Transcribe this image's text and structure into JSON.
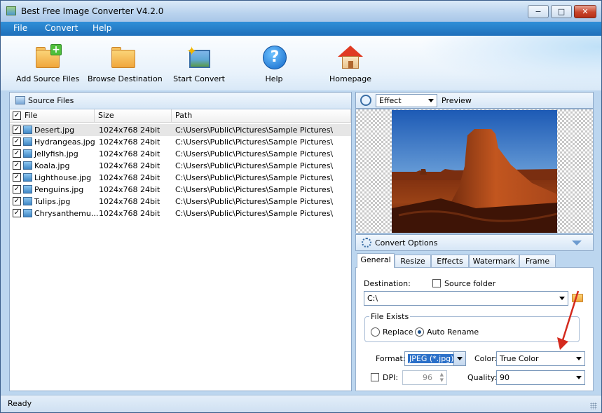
{
  "window": {
    "title": "Best Free Image Converter V4.2.0",
    "controls": {
      "minimize": "−",
      "maximize": "□",
      "close": "✕"
    }
  },
  "menubar": {
    "items": [
      "File",
      "Convert",
      "Help"
    ]
  },
  "toolbar": {
    "add_source_files": "Add Source Files",
    "browse_destination": "Browse Destination",
    "start_convert": "Start Convert",
    "help": "Help",
    "homepage": "Homepage"
  },
  "source_files": {
    "title": "Source Files",
    "columns": {
      "file": "File",
      "size": "Size",
      "path": "Path"
    },
    "rows": [
      {
        "checked": true,
        "file": "Desert.jpg",
        "size": "1024x768  24bit",
        "path": "C:\\Users\\Public\\Pictures\\Sample Pictures\\"
      },
      {
        "checked": true,
        "file": "Hydrangeas.jpg",
        "size": "1024x768  24bit",
        "path": "C:\\Users\\Public\\Pictures\\Sample Pictures\\"
      },
      {
        "checked": true,
        "file": "Jellyfish.jpg",
        "size": "1024x768  24bit",
        "path": "C:\\Users\\Public\\Pictures\\Sample Pictures\\"
      },
      {
        "checked": true,
        "file": "Koala.jpg",
        "size": "1024x768  24bit",
        "path": "C:\\Users\\Public\\Pictures\\Sample Pictures\\"
      },
      {
        "checked": true,
        "file": "Lighthouse.jpg",
        "size": "1024x768  24bit",
        "path": "C:\\Users\\Public\\Pictures\\Sample Pictures\\"
      },
      {
        "checked": true,
        "file": "Penguins.jpg",
        "size": "1024x768  24bit",
        "path": "C:\\Users\\Public\\Pictures\\Sample Pictures\\"
      },
      {
        "checked": true,
        "file": "Tulips.jpg",
        "size": "1024x768  24bit",
        "path": "C:\\Users\\Public\\Pictures\\Sample Pictures\\"
      },
      {
        "checked": true,
        "file": "Chrysanthemu...",
        "size": "1024x768  24bit",
        "path": "C:\\Users\\Public\\Pictures\\Sample Pictures\\"
      }
    ]
  },
  "preview": {
    "effect_value": "Effect",
    "label": "Preview"
  },
  "convert_options": {
    "title": "Convert Options",
    "tabs": [
      "General",
      "Resize",
      "Effects",
      "Watermark",
      "Frame"
    ],
    "active_tab": "General",
    "destination_label": "Destination:",
    "source_folder_label": "Source folder",
    "source_folder_checked": false,
    "destination_value": "C:\\",
    "file_exists_title": "File Exists",
    "replace_label": "Replace",
    "auto_rename_label": "Auto Rename",
    "selected_option": "Auto Rename",
    "format_label": "Format:",
    "format_value": "JPEG (*.jpg)",
    "color_label": "Color:",
    "color_value": "True Color",
    "dpi_label": "DPI:",
    "dpi_value": "96",
    "dpi_checked": false,
    "quality_label": "Quality:",
    "quality_value": "90"
  },
  "status": {
    "text": "Ready"
  },
  "colors": {
    "accent": "#1f6fba",
    "annotation_arrow": "#d42a1e"
  }
}
